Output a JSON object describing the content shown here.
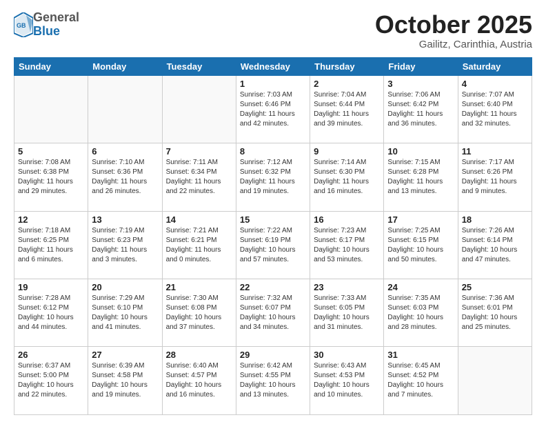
{
  "logo": {
    "general": "General",
    "blue": "Blue"
  },
  "header": {
    "month": "October 2025",
    "location": "Gailitz, Carinthia, Austria"
  },
  "weekdays": [
    "Sunday",
    "Monday",
    "Tuesday",
    "Wednesday",
    "Thursday",
    "Friday",
    "Saturday"
  ],
  "weeks": [
    [
      {
        "day": "",
        "info": ""
      },
      {
        "day": "",
        "info": ""
      },
      {
        "day": "",
        "info": ""
      },
      {
        "day": "1",
        "info": "Sunrise: 7:03 AM\nSunset: 6:46 PM\nDaylight: 11 hours\nand 42 minutes."
      },
      {
        "day": "2",
        "info": "Sunrise: 7:04 AM\nSunset: 6:44 PM\nDaylight: 11 hours\nand 39 minutes."
      },
      {
        "day": "3",
        "info": "Sunrise: 7:06 AM\nSunset: 6:42 PM\nDaylight: 11 hours\nand 36 minutes."
      },
      {
        "day": "4",
        "info": "Sunrise: 7:07 AM\nSunset: 6:40 PM\nDaylight: 11 hours\nand 32 minutes."
      }
    ],
    [
      {
        "day": "5",
        "info": "Sunrise: 7:08 AM\nSunset: 6:38 PM\nDaylight: 11 hours\nand 29 minutes."
      },
      {
        "day": "6",
        "info": "Sunrise: 7:10 AM\nSunset: 6:36 PM\nDaylight: 11 hours\nand 26 minutes."
      },
      {
        "day": "7",
        "info": "Sunrise: 7:11 AM\nSunset: 6:34 PM\nDaylight: 11 hours\nand 22 minutes."
      },
      {
        "day": "8",
        "info": "Sunrise: 7:12 AM\nSunset: 6:32 PM\nDaylight: 11 hours\nand 19 minutes."
      },
      {
        "day": "9",
        "info": "Sunrise: 7:14 AM\nSunset: 6:30 PM\nDaylight: 11 hours\nand 16 minutes."
      },
      {
        "day": "10",
        "info": "Sunrise: 7:15 AM\nSunset: 6:28 PM\nDaylight: 11 hours\nand 13 minutes."
      },
      {
        "day": "11",
        "info": "Sunrise: 7:17 AM\nSunset: 6:26 PM\nDaylight: 11 hours\nand 9 minutes."
      }
    ],
    [
      {
        "day": "12",
        "info": "Sunrise: 7:18 AM\nSunset: 6:25 PM\nDaylight: 11 hours\nand 6 minutes."
      },
      {
        "day": "13",
        "info": "Sunrise: 7:19 AM\nSunset: 6:23 PM\nDaylight: 11 hours\nand 3 minutes."
      },
      {
        "day": "14",
        "info": "Sunrise: 7:21 AM\nSunset: 6:21 PM\nDaylight: 11 hours\nand 0 minutes."
      },
      {
        "day": "15",
        "info": "Sunrise: 7:22 AM\nSunset: 6:19 PM\nDaylight: 10 hours\nand 57 minutes."
      },
      {
        "day": "16",
        "info": "Sunrise: 7:23 AM\nSunset: 6:17 PM\nDaylight: 10 hours\nand 53 minutes."
      },
      {
        "day": "17",
        "info": "Sunrise: 7:25 AM\nSunset: 6:15 PM\nDaylight: 10 hours\nand 50 minutes."
      },
      {
        "day": "18",
        "info": "Sunrise: 7:26 AM\nSunset: 6:14 PM\nDaylight: 10 hours\nand 47 minutes."
      }
    ],
    [
      {
        "day": "19",
        "info": "Sunrise: 7:28 AM\nSunset: 6:12 PM\nDaylight: 10 hours\nand 44 minutes."
      },
      {
        "day": "20",
        "info": "Sunrise: 7:29 AM\nSunset: 6:10 PM\nDaylight: 10 hours\nand 41 minutes."
      },
      {
        "day": "21",
        "info": "Sunrise: 7:30 AM\nSunset: 6:08 PM\nDaylight: 10 hours\nand 37 minutes."
      },
      {
        "day": "22",
        "info": "Sunrise: 7:32 AM\nSunset: 6:07 PM\nDaylight: 10 hours\nand 34 minutes."
      },
      {
        "day": "23",
        "info": "Sunrise: 7:33 AM\nSunset: 6:05 PM\nDaylight: 10 hours\nand 31 minutes."
      },
      {
        "day": "24",
        "info": "Sunrise: 7:35 AM\nSunset: 6:03 PM\nDaylight: 10 hours\nand 28 minutes."
      },
      {
        "day": "25",
        "info": "Sunrise: 7:36 AM\nSunset: 6:01 PM\nDaylight: 10 hours\nand 25 minutes."
      }
    ],
    [
      {
        "day": "26",
        "info": "Sunrise: 6:37 AM\nSunset: 5:00 PM\nDaylight: 10 hours\nand 22 minutes."
      },
      {
        "day": "27",
        "info": "Sunrise: 6:39 AM\nSunset: 4:58 PM\nDaylight: 10 hours\nand 19 minutes."
      },
      {
        "day": "28",
        "info": "Sunrise: 6:40 AM\nSunset: 4:57 PM\nDaylight: 10 hours\nand 16 minutes."
      },
      {
        "day": "29",
        "info": "Sunrise: 6:42 AM\nSunset: 4:55 PM\nDaylight: 10 hours\nand 13 minutes."
      },
      {
        "day": "30",
        "info": "Sunrise: 6:43 AM\nSunset: 4:53 PM\nDaylight: 10 hours\nand 10 minutes."
      },
      {
        "day": "31",
        "info": "Sunrise: 6:45 AM\nSunset: 4:52 PM\nDaylight: 10 hours\nand 7 minutes."
      },
      {
        "day": "",
        "info": ""
      }
    ]
  ]
}
